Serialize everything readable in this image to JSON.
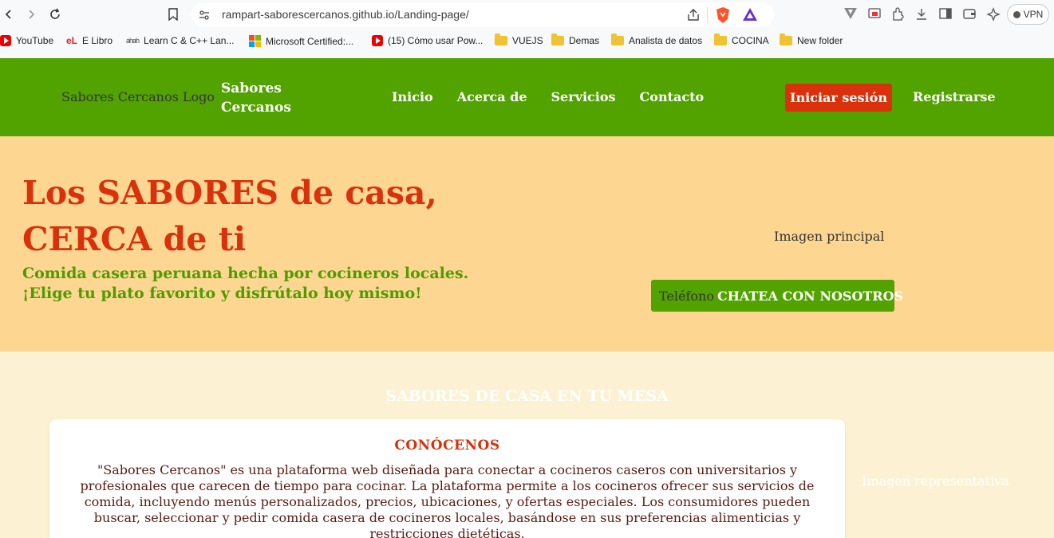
{
  "browser": {
    "url": "rampart-saborescercanos.github.io/Landing-page/",
    "vpn_label": "VPN",
    "bookmarks": [
      {
        "label": "YouTube",
        "icon": "youtube-icon"
      },
      {
        "label": "E Libro",
        "icon": "elibro-icon"
      },
      {
        "label": "Learn C & C++ Lan...",
        "icon": "cisco-icon"
      },
      {
        "label": "Microsoft Certified:...",
        "icon": "microsoft-icon"
      },
      {
        "label": "(15) Cómo usar Pow...",
        "icon": "youtube-icon"
      },
      {
        "label": "VUEJS",
        "icon": "folder-icon"
      },
      {
        "label": "Demas",
        "icon": "folder-icon"
      },
      {
        "label": "Analista de datos",
        "icon": "folder-icon"
      },
      {
        "label": "COCINA",
        "icon": "folder-icon"
      },
      {
        "label": "New folder",
        "icon": "folder-icon"
      }
    ],
    "elibro_mark": "eL",
    "cisco_mark": "ahah"
  },
  "header": {
    "logo_alt": "Sabores Cercanos Logo",
    "brand_line1": "Sabores",
    "brand_line2": "Cercanos",
    "nav": [
      "Inicio",
      "Acerca de",
      "Servicios",
      "Contacto"
    ],
    "login_label": "Iniciar sesión",
    "register_label": "Registrarse"
  },
  "hero": {
    "title_line1": "Los SABORES de casa,",
    "title_line2": "CERCA de ti",
    "subtitle_line1": "Comida casera peruana hecha por cocineros locales.",
    "subtitle_line2": "¡Elige tu plato favorito y disfrútalo hoy mismo!",
    "image_alt": "Imagen principal",
    "chat_icon_alt": "Teléfono",
    "chat_label": "CHATEA CON NOSOTROS"
  },
  "about": {
    "section_title": "SABORES DE CASA EN TU MESA",
    "card_title": "CONÓCENOS",
    "card_text": "\"Sabores Cercanos\" es una plataforma web diseñada para conectar a cocineros caseros con universitarios y profesionales que carecen de tiempo para cocinar. La plataforma permite a los cocineros ofrecer sus servicios de comida, incluyendo menús personalizados, precios, ubicaciones, y ofertas especiales. Los consumidores pueden buscar, seleccionar y pedir comida casera de cocineros locales, basándose en sus preferencias alimenticias y restricciones dietéticas.",
    "side_image_alt": "Imagen representativa"
  },
  "colors": {
    "header_green": "#52a300",
    "accent_red": "#d9310b",
    "hero_bg": "#fdd692",
    "section_bg": "#fcf2d3"
  }
}
